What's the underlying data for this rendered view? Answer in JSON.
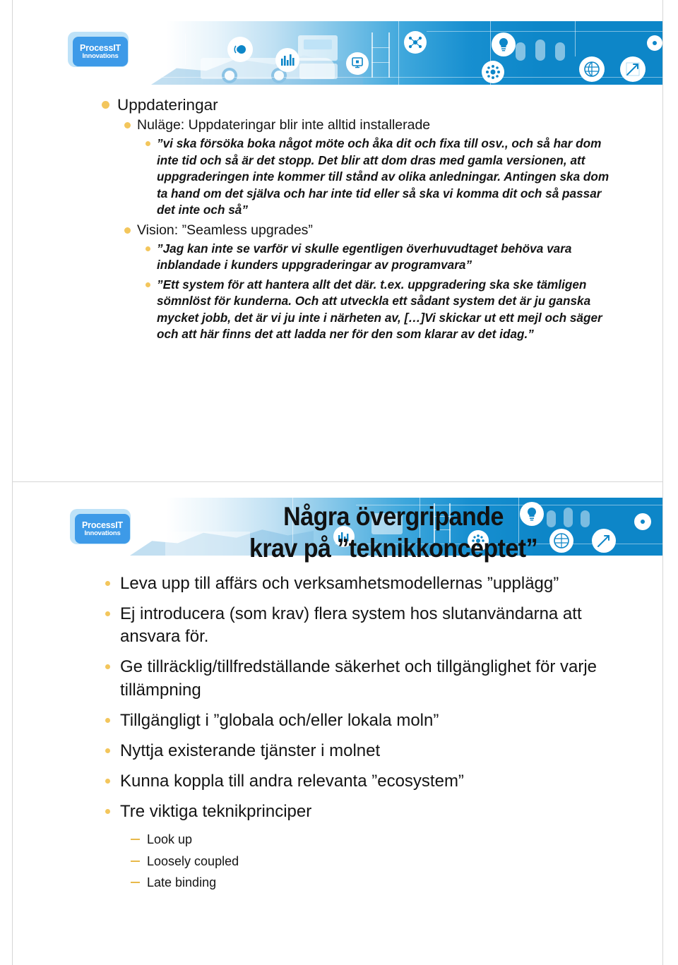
{
  "document": {
    "type": "presentation-handout",
    "slide_count": 2
  },
  "colors": {
    "bullet_gold": "#f3c65c",
    "dash_gold": "#e8b94a",
    "banner_blue": "#0d86c8",
    "logo_blue": "#3d9ae8",
    "logo_halo": "#a8d8f5",
    "text_black": "#141414",
    "page_border": "#d6d6d6"
  },
  "logo": {
    "name": "ProcessIT",
    "tagline": "Innovations"
  },
  "slide1": {
    "banner_icons": [
      "bar-chart-icon",
      "monitor-network-icon",
      "molecule-icon",
      "globe-signal-icon",
      "gauge-meter-icon",
      "crane-icon",
      "excavator-icon"
    ],
    "items": [
      {
        "level": 1,
        "text": "Uppdateringar"
      },
      {
        "level": 2,
        "text": "Nuläge: Uppdateringar blir inte alltid installerade"
      },
      {
        "level": 3,
        "text": "”vi ska försöka boka något möte och åka dit och fixa till osv., och så har dom inte tid och så är det stopp. Det blir att dom dras med gamla versionen, att uppgraderingen inte kommer till stånd av olika anledningar. Antingen ska dom ta hand om det själva och har inte tid eller så ska vi komma dit och så passar det inte och så”"
      },
      {
        "level": 2,
        "text": "Vision: ”Seamless upgrades”"
      },
      {
        "level": 3,
        "text": "”Jag kan inte se varför vi skulle egentligen överhuvudtaget behöva vara inblandade i kunders uppgraderingar av programvara”"
      },
      {
        "level": 3,
        "text": "”Ett system för att hantera allt det där. t.ex. uppgradering ska ske tämligen sömnlöst för kunderna. Och att utveckla ett sådant system det är ju ganska mycket jobb, det är vi ju inte i närheten av, […]Vi skickar ut ett mejl och säger och att här finns det att ladda ner för den som klarar av det idag.”"
      }
    ]
  },
  "slide2": {
    "title_line1": "Några övergripande",
    "title_line2": "krav på ”teknikkonceptet”",
    "banner_icons": [
      "lightbulb-icon",
      "molecule-icon",
      "globe-icon",
      "arrow-up-right-icon",
      "bar-chart-icon",
      "gauge-meter-icon",
      "crane-icon"
    ],
    "items": [
      {
        "level": 1,
        "text": "Leva upp till affärs och verksamhetsmodellernas ”upplägg”"
      },
      {
        "level": 1,
        "text": "Ej introducera (som krav) flera system hos slutanvändarna att ansvara för."
      },
      {
        "level": 1,
        "text": "Ge tillräcklig/tillfredställande säkerhet och tillgänglighet för varje tillämpning"
      },
      {
        "level": 1,
        "text": "Tillgängligt i ”globala och/eller lokala moln”"
      },
      {
        "level": 1,
        "text": "Nyttja existerande tjänster i molnet"
      },
      {
        "level": 1,
        "text": "Kunna koppla till andra relevanta ”ecosystem”"
      },
      {
        "level": 1,
        "text": "Tre viktiga teknikprinciper"
      },
      {
        "level": 2,
        "text": "Look up"
      },
      {
        "level": 2,
        "text": "Loosely coupled"
      },
      {
        "level": 2,
        "text": "Late binding"
      }
    ]
  }
}
